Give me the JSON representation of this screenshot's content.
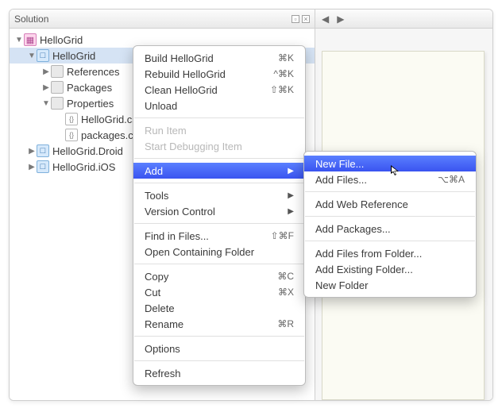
{
  "header": {
    "title": "Solution"
  },
  "tree": {
    "root": {
      "label": "HelloGrid"
    },
    "proj": {
      "label": "HelloGrid"
    },
    "refs": {
      "label": "References"
    },
    "pkgs": {
      "label": "Packages"
    },
    "props": {
      "label": "Properties"
    },
    "file_cs": {
      "label": "HelloGrid.cs"
    },
    "file_cfg": {
      "label": "packages.config"
    },
    "droid": {
      "label": "HelloGrid.Droid"
    },
    "ios": {
      "label": "HelloGrid.iOS"
    }
  },
  "menu1": {
    "build": {
      "label": "Build HelloGrid",
      "sc": "⌘K"
    },
    "rebuild": {
      "label": "Rebuild HelloGrid",
      "sc": "^⌘K"
    },
    "clean": {
      "label": "Clean HelloGrid",
      "sc": "⇧⌘K"
    },
    "unload": {
      "label": "Unload"
    },
    "run": {
      "label": "Run Item"
    },
    "debug": {
      "label": "Start Debugging Item"
    },
    "add": {
      "label": "Add"
    },
    "tools": {
      "label": "Tools"
    },
    "vc": {
      "label": "Version Control"
    },
    "find": {
      "label": "Find in Files...",
      "sc": "⇧⌘F"
    },
    "open": {
      "label": "Open Containing Folder"
    },
    "copy": {
      "label": "Copy",
      "sc": "⌘C"
    },
    "cut": {
      "label": "Cut",
      "sc": "⌘X"
    },
    "delete": {
      "label": "Delete"
    },
    "rename": {
      "label": "Rename",
      "sc": "⌘R"
    },
    "options": {
      "label": "Options"
    },
    "refresh": {
      "label": "Refresh"
    }
  },
  "menu2": {
    "newfile": {
      "label": "New File..."
    },
    "addfiles": {
      "label": "Add Files...",
      "sc": "⌥⌘A"
    },
    "webref": {
      "label": "Add Web Reference"
    },
    "addpkg": {
      "label": "Add Packages..."
    },
    "fromfolder": {
      "label": "Add Files from Folder..."
    },
    "existfolder": {
      "label": "Add Existing Folder..."
    },
    "newfolder": {
      "label": "New Folder"
    }
  }
}
